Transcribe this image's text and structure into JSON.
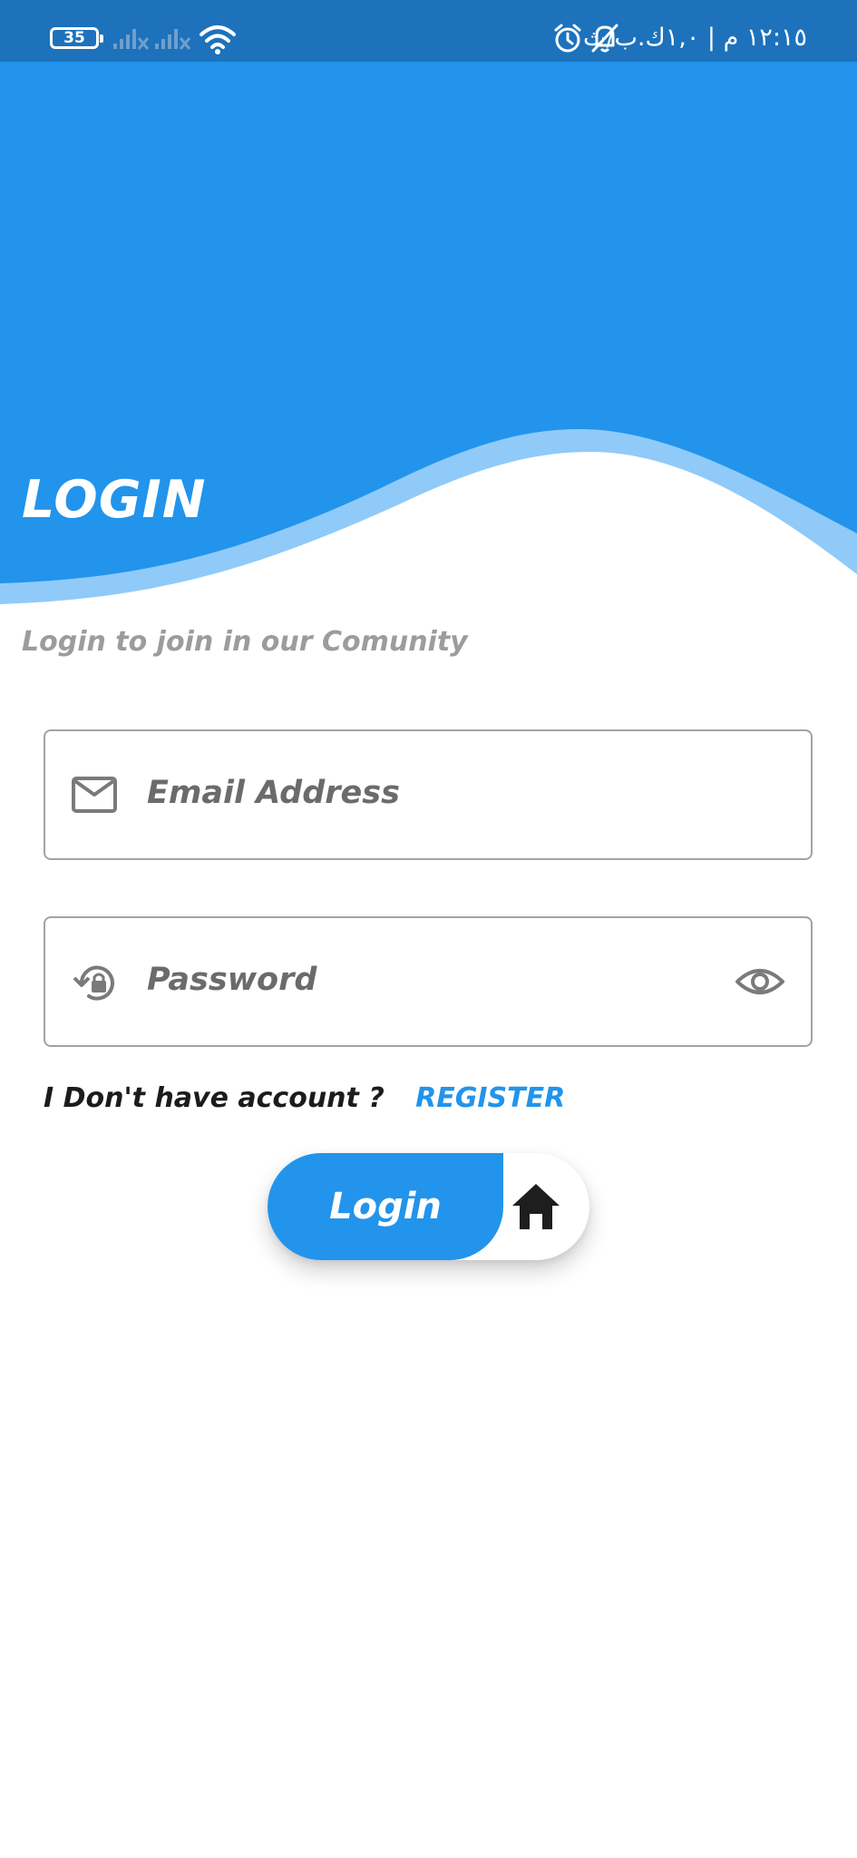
{
  "status_bar": {
    "battery_level": "35",
    "time_text": "١٢:١٥ م | ١,٠ك.ب/ث",
    "icons": [
      "battery-icon",
      "signal-no-service-icon",
      "signal-no-service-icon",
      "wifi-icon",
      "alarm-icon",
      "bell-off-icon"
    ]
  },
  "header": {
    "title": "LOGIN",
    "subtitle": "Login to join in our Comunity"
  },
  "form": {
    "email": {
      "placeholder": "Email Address",
      "icon": "mail-icon"
    },
    "password": {
      "placeholder": "Password",
      "icon": "lock-reset-icon",
      "toggle_icon": "eye-icon"
    }
  },
  "account": {
    "prompt": "I Don't have account ?",
    "register_label": "REGISTER"
  },
  "actions": {
    "login_label": "Login",
    "home_icon": "home-icon"
  },
  "colors": {
    "primary": "#2294eb",
    "status_bar": "#1d72bb",
    "wave_light": "#90caf9",
    "muted_text": "#9c9c9c",
    "field_border": "#a3a3a3"
  }
}
